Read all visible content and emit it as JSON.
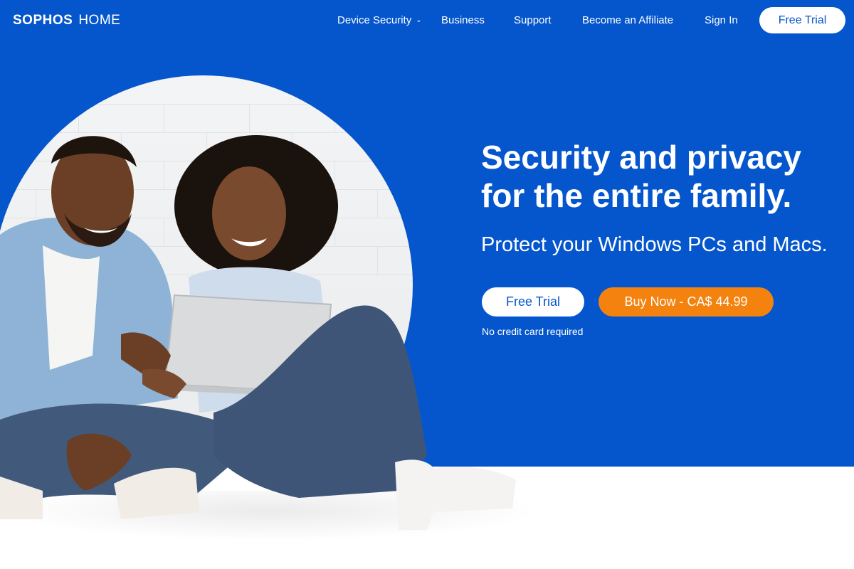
{
  "brand": {
    "name": "SOPHOS",
    "product": "HOME"
  },
  "nav": {
    "items": [
      {
        "label": "Device Security",
        "has_dropdown": true
      },
      {
        "label": "Business"
      },
      {
        "label": "Support"
      },
      {
        "label": "Become an Affiliate"
      },
      {
        "label": "Sign In"
      }
    ],
    "cta_label": "Free Trial"
  },
  "hero": {
    "headline_line1": "Security and privacy",
    "headline_line2": "for the entire family.",
    "subhead": "Protect your Windows PCs and Macs.",
    "trial_label": "Free Trial",
    "buy_label": "Buy Now -  CA$ 44.99",
    "note": "No credit card required"
  },
  "colors": {
    "brand_blue": "#0556cc",
    "accent_orange": "#f4820f",
    "white": "#ffffff"
  },
  "icons": {
    "dropdown": "chevron-down-icon"
  }
}
